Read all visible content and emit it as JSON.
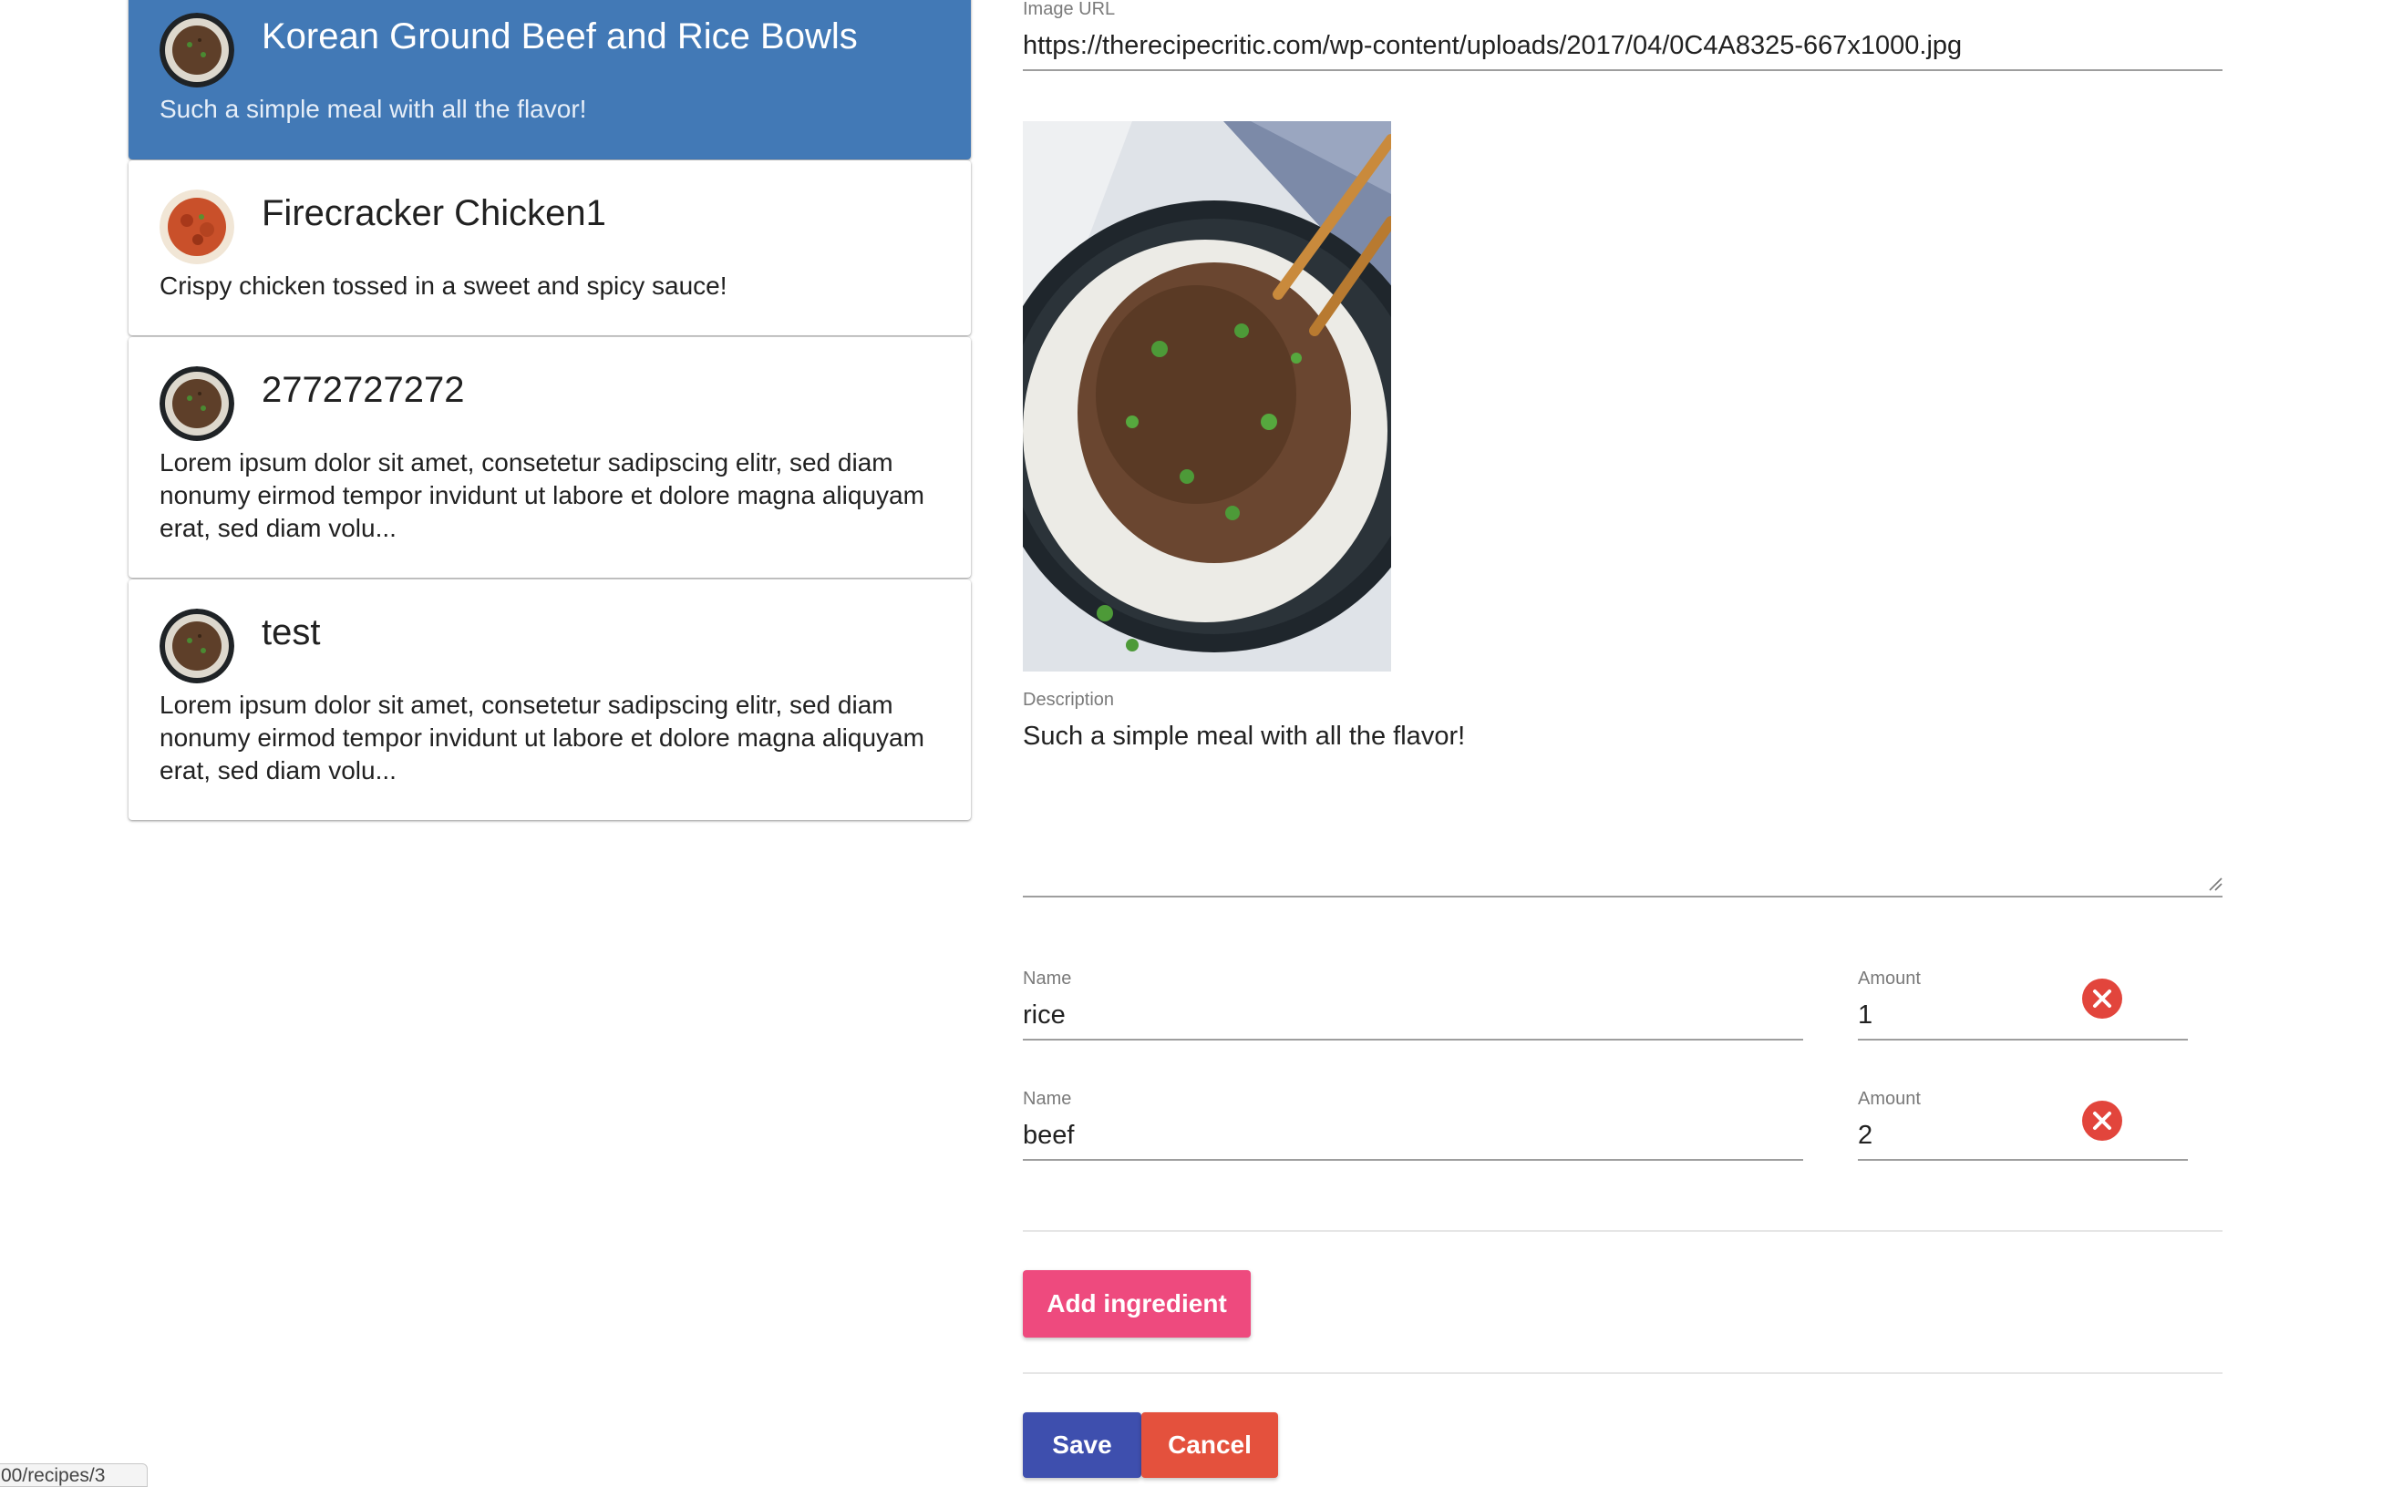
{
  "recipes": [
    {
      "title": "Korean Ground Beef and Rice Bowls",
      "description": "Such a simple meal with all the flavor!",
      "thumbnail": "beef-rice-bowl"
    },
    {
      "title": "Firecracker Chicken1",
      "description": "Crispy chicken tossed in a sweet and spicy sauce!",
      "thumbnail": "firecracker-chicken"
    },
    {
      "title": "2772727272",
      "description": "Lorem ipsum dolor sit amet, consetetur sadipscing elitr, sed diam nonumy eirmod tempor invidunt ut labore et dolore magna aliquyam erat, sed diam volu...",
      "thumbnail": "beef-rice-bowl"
    },
    {
      "title": "test",
      "description": "Lorem ipsum dolor sit amet, consetetur sadipscing elitr, sed diam nonumy eirmod tempor invidunt ut labore et dolore magna aliquyam erat, sed diam volu...",
      "thumbnail": "beef-rice-bowl"
    }
  ],
  "form": {
    "image_url_label": "Image URL",
    "image_url": "https://therecipecritic.com/wp-content/uploads/2017/04/0C4A8325-667x1000.jpg",
    "description_label": "Description",
    "description": "Such a simple meal with all the flavor!",
    "ingredients": [
      {
        "name_label": "Name",
        "name": "rice",
        "amount_label": "Amount",
        "amount": "1"
      },
      {
        "name_label": "Name",
        "name": "beef",
        "amount_label": "Amount",
        "amount": "2"
      }
    ],
    "add_ingredient_label": "Add ingredient",
    "save_label": "Save",
    "cancel_label": "Cancel"
  },
  "status_bar_url": "00/recipes/3",
  "colors": {
    "active_card": "#4279b6",
    "add_button": "#ee4a7e",
    "save_button": "#3e4fae",
    "cancel_button": "#e4513d",
    "remove_icon": "#e2453c"
  },
  "icons": {
    "remove": "close-circle-icon",
    "resize": "resize-grip-icon"
  }
}
